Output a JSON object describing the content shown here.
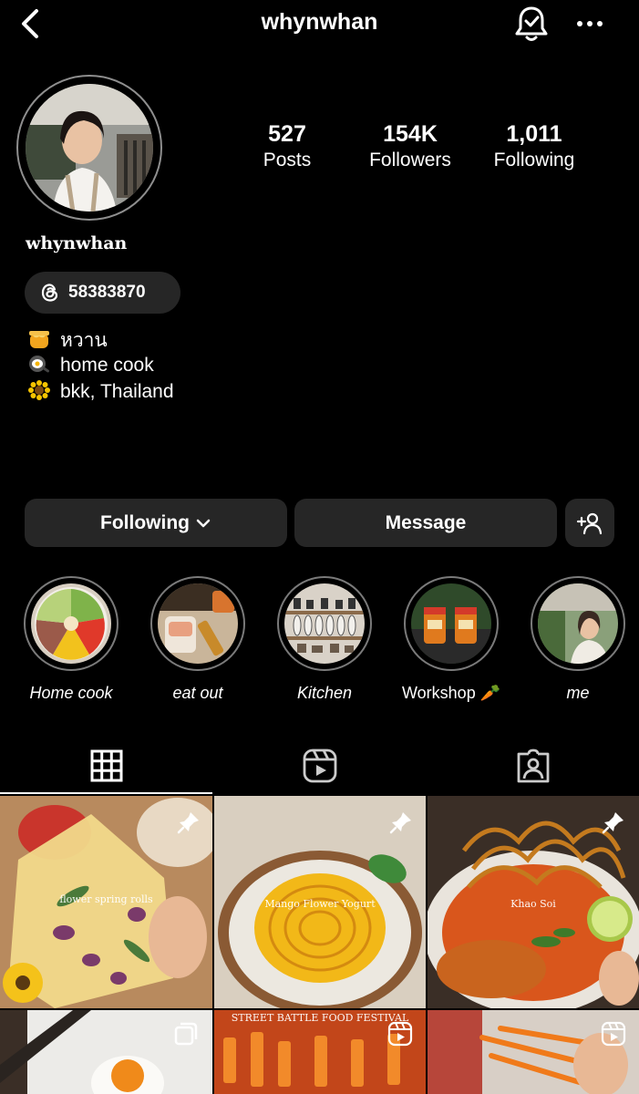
{
  "header": {
    "title": "whynwhan",
    "back_icon": "chevron-left-icon",
    "notification_icon": "bell-check-icon",
    "more_icon": "more-horizontal-icon"
  },
  "profile": {
    "name": "whynwhan",
    "stats": [
      {
        "value": "527",
        "label": "Posts"
      },
      {
        "value": "154K",
        "label": "Followers"
      },
      {
        "value": "1,011",
        "label": "Following"
      }
    ],
    "threads_badge": "58383870",
    "bio": [
      {
        "emoji": "honey-pot-icon",
        "text": "หวาน"
      },
      {
        "emoji": "frying-pan-egg-icon",
        "text": "home cook"
      },
      {
        "emoji": "sunflower-icon",
        "text": "bkk, Thailand"
      }
    ]
  },
  "actions": {
    "following_label": "Following",
    "message_label": "Message"
  },
  "highlights": [
    {
      "label": "Home cook"
    },
    {
      "label": "eat out"
    },
    {
      "label": "Kitchen"
    },
    {
      "label": "Workshop 🥕"
    },
    {
      "label": "me"
    }
  ],
  "tabs": [
    "grid-icon",
    "reels-icon",
    "tagged-icon"
  ],
  "posts": [
    {
      "overlay": "flower spring rolls",
      "badge": "pin-icon"
    },
    {
      "overlay": "Mango Flower Yogurt",
      "badge": "pin-icon"
    },
    {
      "overlay": "Khao Soi",
      "badge": "pin-icon"
    },
    {
      "overlay": "",
      "badge": "carousel-icon"
    },
    {
      "overlay": "STREET BATTLE FOOD FESTIVAL",
      "badge": "reels-icon"
    },
    {
      "overlay": "",
      "badge": "reels-icon"
    }
  ],
  "colors": {
    "background": "#000000",
    "button": "#262626",
    "ring": "#8e8e8e"
  }
}
